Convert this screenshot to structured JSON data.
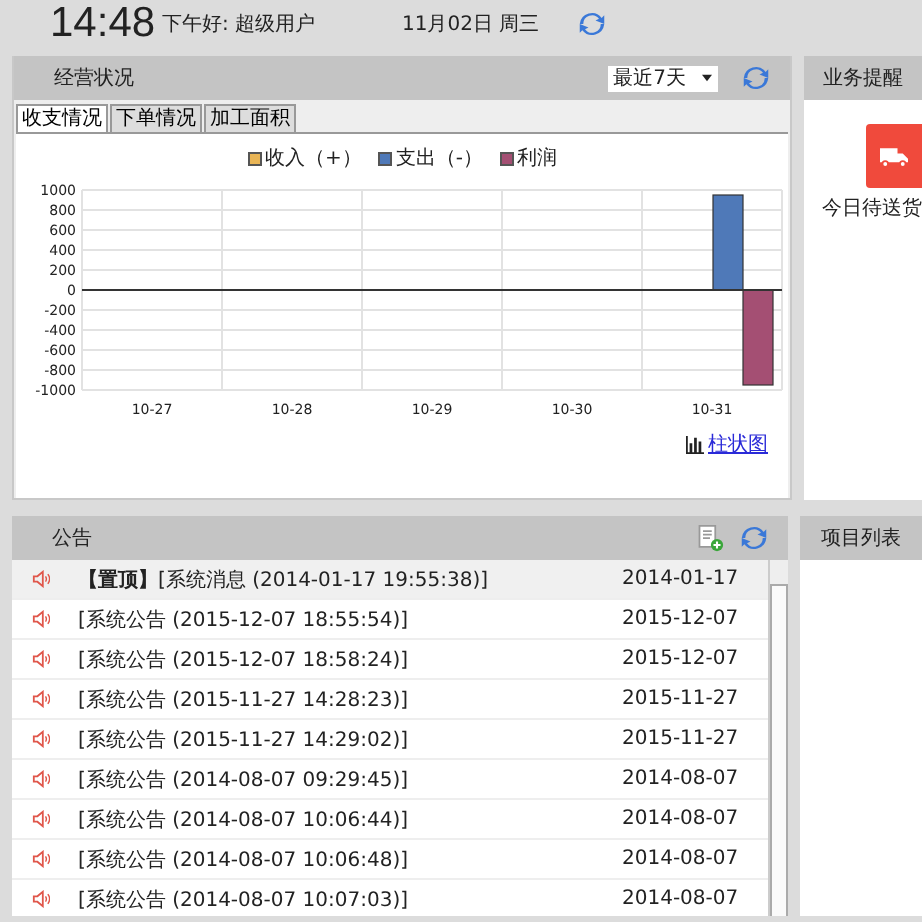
{
  "top_bar": {
    "time": "14:48",
    "greeting": "下午好: 超级用户",
    "date": "11月02日 周三"
  },
  "business_panel": {
    "title": "经营状况",
    "range_select": {
      "value": "最近7天"
    },
    "tabs": [
      {
        "label": "收支情况",
        "selected": true
      },
      {
        "label": "下单情况",
        "selected": false
      },
      {
        "label": "加工面积",
        "selected": false
      }
    ],
    "chart_data": {
      "type": "bar",
      "categories": [
        "10-27",
        "10-28",
        "10-29",
        "10-30",
        "10-31"
      ],
      "series": [
        {
          "name": "收入（+）",
          "color": "#e9b556",
          "values": [
            0,
            0,
            0,
            0,
            0
          ]
        },
        {
          "name": "支出（-）",
          "color": "#4f79b8",
          "values": [
            0,
            0,
            0,
            0,
            950
          ]
        },
        {
          "name": "利润",
          "color": "#a44f73",
          "values": [
            0,
            0,
            0,
            0,
            -950
          ]
        }
      ],
      "ylim": [
        -1000,
        1000
      ],
      "grid": true,
      "yticks": [
        -1000,
        -800,
        -600,
        -400,
        -200,
        0,
        200,
        400,
        600,
        800,
        1000
      ]
    },
    "chart_link": "柱状图"
  },
  "reminder_panel": {
    "title": "业务提醒",
    "tiles": [
      {
        "label": "今日待送货"
      }
    ]
  },
  "notice_panel": {
    "title": "公告",
    "rows": [
      {
        "title": "**【置顶】**[系统消息 (2014-01-17 19:55:38)]",
        "date": "2014-01-17",
        "selected": true
      },
      {
        "title": "[系统公告 (2015-12-07 18:55:54)]",
        "date": "2015-12-07",
        "selected": false
      },
      {
        "title": "[系统公告 (2015-12-07 18:58:24)]",
        "date": "2015-12-07",
        "selected": false
      },
      {
        "title": "[系统公告 (2015-11-27 14:28:23)]",
        "date": "2015-11-27",
        "selected": false
      },
      {
        "title": "[系统公告 (2015-11-27 14:29:02)]",
        "date": "2015-11-27",
        "selected": false
      },
      {
        "title": "[系统公告 (2014-08-07 09:29:45)]",
        "date": "2014-08-07",
        "selected": false
      },
      {
        "title": "[系统公告 (2014-08-07 10:06:44)]",
        "date": "2014-08-07",
        "selected": false
      },
      {
        "title": "[系统公告 (2014-08-07 10:06:48)]",
        "date": "2014-08-07",
        "selected": false
      },
      {
        "title": "[系统公告 (2014-08-07 10:07:03)]",
        "date": "2014-08-07",
        "selected": false
      }
    ]
  },
  "project_panel": {
    "title": "项目列表"
  }
}
